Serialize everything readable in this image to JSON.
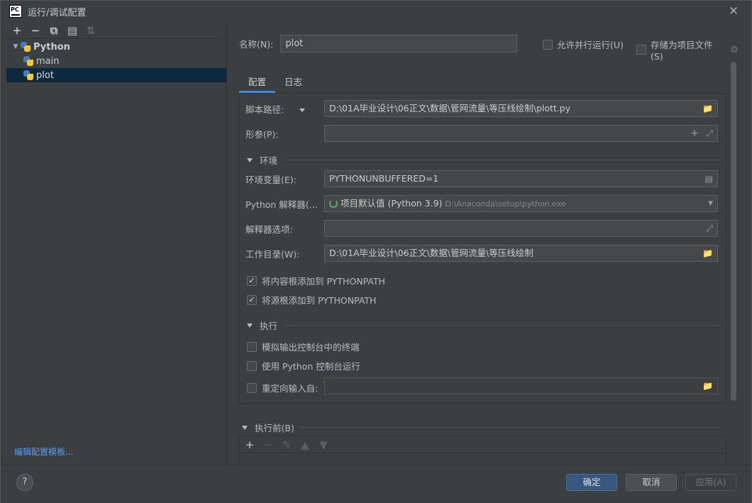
{
  "window": {
    "title": "运行/调试配置",
    "app_icon_text": "PC"
  },
  "left": {
    "toolbar": [
      "+",
      "−",
      "⧉",
      "▤",
      "↓a"
    ],
    "tree": [
      {
        "label": "Python",
        "level": 0,
        "expanded": true,
        "selected": false
      },
      {
        "label": "main",
        "level": 1,
        "selected": false
      },
      {
        "label": "plot",
        "level": 1,
        "selected": true
      }
    ],
    "edit_templates_link": "编辑配置模板..."
  },
  "header": {
    "name_label": "名称(N):",
    "name_value": "plot",
    "allow_parallel_label": "允许并行运行(U)",
    "allow_parallel_checked": false,
    "store_as_file_label": "存储为项目文件(S)",
    "store_as_file_checked": false
  },
  "tabs": [
    {
      "label": "配置",
      "active": true
    },
    {
      "label": "日志",
      "active": false
    }
  ],
  "config": {
    "script_path_label": "脚本路径:",
    "script_path_value": "D:\\01A毕业设计\\06正文\\数据\\管网流量\\等压线绘制\\plott.py",
    "params_label": "形参(P):",
    "params_value": "",
    "env_section": "环境",
    "env_vars_label": "环境变量(E):",
    "env_vars_value": "PYTHONUNBUFFERED=1",
    "interpreter_label": "Python 解释器(...",
    "interpreter_value": "项目默认值 (Python 3.9)",
    "interpreter_path": "D:\\Anaconda\\setup\\python.exe",
    "interp_options_label": "解释器选项:",
    "interp_options_value": "",
    "workdir_label": "工作目录(W):",
    "workdir_value": "D:\\01A毕业设计\\06正文\\数据\\管网流量\\等压线绘制",
    "add_content_roots_label": "将内容根添加到 PYTHONPATH",
    "add_content_roots_checked": true,
    "add_source_roots_label": "将源根添加到 PYTHONPATH",
    "add_source_roots_checked": true,
    "exec_section": "执行",
    "emulate_terminal_label": "模拟输出控制台中的终端",
    "emulate_terminal_checked": false,
    "python_console_label": "使用 Python 控制台运行",
    "python_console_checked": false,
    "redirect_input_label": "重定向输入自:",
    "redirect_input_checked": false,
    "redirect_input_value": ""
  },
  "before_launch": {
    "label": "执行前(B)"
  },
  "footer": {
    "help": "?",
    "ok": "确定",
    "cancel": "取消",
    "apply": "应用(A)"
  }
}
